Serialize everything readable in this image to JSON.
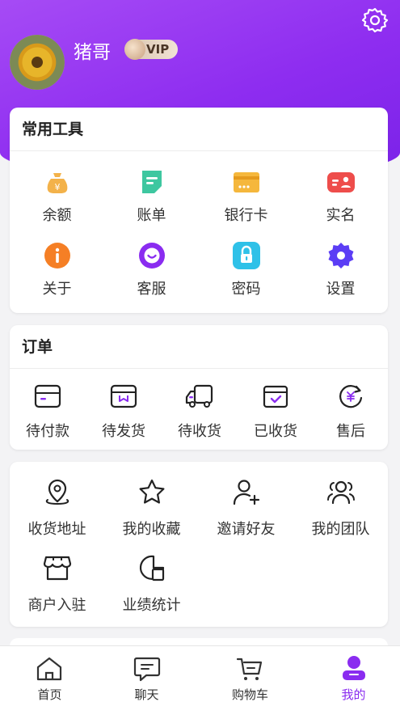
{
  "profile": {
    "username": "猪哥",
    "badge": "VIP"
  },
  "tools": {
    "title": "常用工具",
    "items": [
      {
        "label": "余额",
        "icon": "money-bag-icon"
      },
      {
        "label": "账单",
        "icon": "bill-icon"
      },
      {
        "label": "银行卡",
        "icon": "bank-card-icon"
      },
      {
        "label": "实名",
        "icon": "id-card-icon"
      },
      {
        "label": "关于",
        "icon": "info-icon"
      },
      {
        "label": "客服",
        "icon": "customer-service-icon"
      },
      {
        "label": "密码",
        "icon": "lock-icon"
      },
      {
        "label": "设置",
        "icon": "gear-icon"
      }
    ]
  },
  "orders": {
    "title": "订单",
    "items": [
      {
        "label": "待付款",
        "icon": "wallet-icon"
      },
      {
        "label": "待发货",
        "icon": "package-icon"
      },
      {
        "label": "待收货",
        "icon": "truck-icon"
      },
      {
        "label": "已收货",
        "icon": "box-check-icon"
      },
      {
        "label": "售后",
        "icon": "refund-icon"
      }
    ]
  },
  "services": {
    "items": [
      {
        "label": "收货地址",
        "icon": "location-icon"
      },
      {
        "label": "我的收藏",
        "icon": "star-icon"
      },
      {
        "label": "邀请好友",
        "icon": "add-user-icon"
      },
      {
        "label": "我的团队",
        "icon": "team-icon"
      },
      {
        "label": "商户入驻",
        "icon": "store-icon"
      },
      {
        "label": "业绩统计",
        "icon": "stats-icon"
      }
    ]
  },
  "nav": {
    "items": [
      {
        "label": "首页",
        "icon": "home-icon"
      },
      {
        "label": "聊天",
        "icon": "chat-icon"
      },
      {
        "label": "购物车",
        "icon": "cart-icon"
      },
      {
        "label": "我的",
        "icon": "profile-icon"
      }
    ],
    "active_color": "#8a2cf0"
  },
  "colors": {
    "brand": "#8e2df0"
  }
}
